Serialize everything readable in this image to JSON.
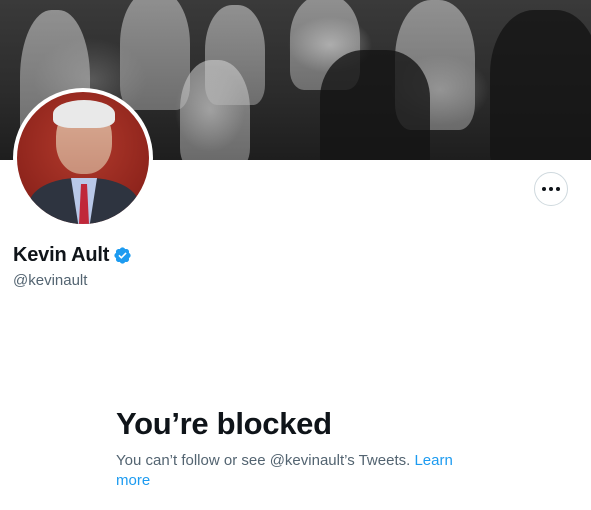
{
  "profile": {
    "display_name": "Kevin Ault",
    "handle": "@kevinault",
    "verified_color": "#1d9bf0"
  },
  "actions": {
    "more_icon": "more-horizontal-icon"
  },
  "blocked": {
    "title": "You’re blocked",
    "message": "You can’t follow or see @kevinault’s Tweets.",
    "link_label": "Learn more"
  }
}
